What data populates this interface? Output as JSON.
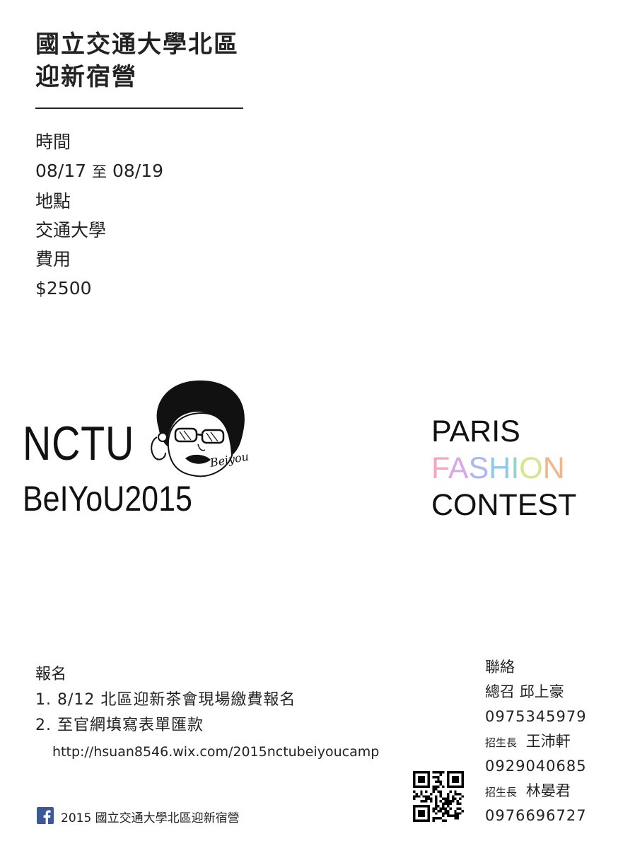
{
  "header": {
    "line1": "國立交通大學北區",
    "line2": "迎新宿營"
  },
  "info": {
    "time_label": "時間",
    "time_start": "08/17",
    "time_connector": "至",
    "time_end": "08/19",
    "place_label": "地點",
    "place_value": "交通大學",
    "fee_label": "費用",
    "fee_value": "$2500"
  },
  "logo": {
    "line1": "NCTU",
    "line2": "BeIYoU2015",
    "script": "Beiyou"
  },
  "theme": {
    "line1": "PARIS",
    "fashion_letters": [
      {
        "ch": "F",
        "color": "#f4a7b9"
      },
      {
        "ch": "A",
        "color": "#d9a6e8"
      },
      {
        "ch": "S",
        "color": "#a9b8f0"
      },
      {
        "ch": "H",
        "color": "#8fc9f2"
      },
      {
        "ch": "I",
        "color": "#8fd6c6"
      },
      {
        "ch": "O",
        "color": "#d6e48a"
      },
      {
        "ch": "N",
        "color": "#f4b58a"
      }
    ],
    "line3": "CONTEST"
  },
  "registration": {
    "label": "報名",
    "item1": "1. 8/12 北區迎新茶會現場繳費報名",
    "item2": "2. 至官網填寫表單匯款",
    "url": "http://hsuan8546.wix.com/2015nctubeiyoucamp"
  },
  "contact": {
    "label": "聯絡",
    "people": [
      {
        "role": "總召",
        "name": "邱上豪",
        "phone": "0975345979"
      },
      {
        "role": "招生長",
        "name": "王沛軒",
        "phone": "0929040685"
      },
      {
        "role": "招生長",
        "name": "林晏君",
        "phone": "0976696727"
      }
    ]
  },
  "footer": {
    "facebook_icon": "facebook-icon",
    "page_name": "2015 國立交通大學北區迎新宿營"
  }
}
